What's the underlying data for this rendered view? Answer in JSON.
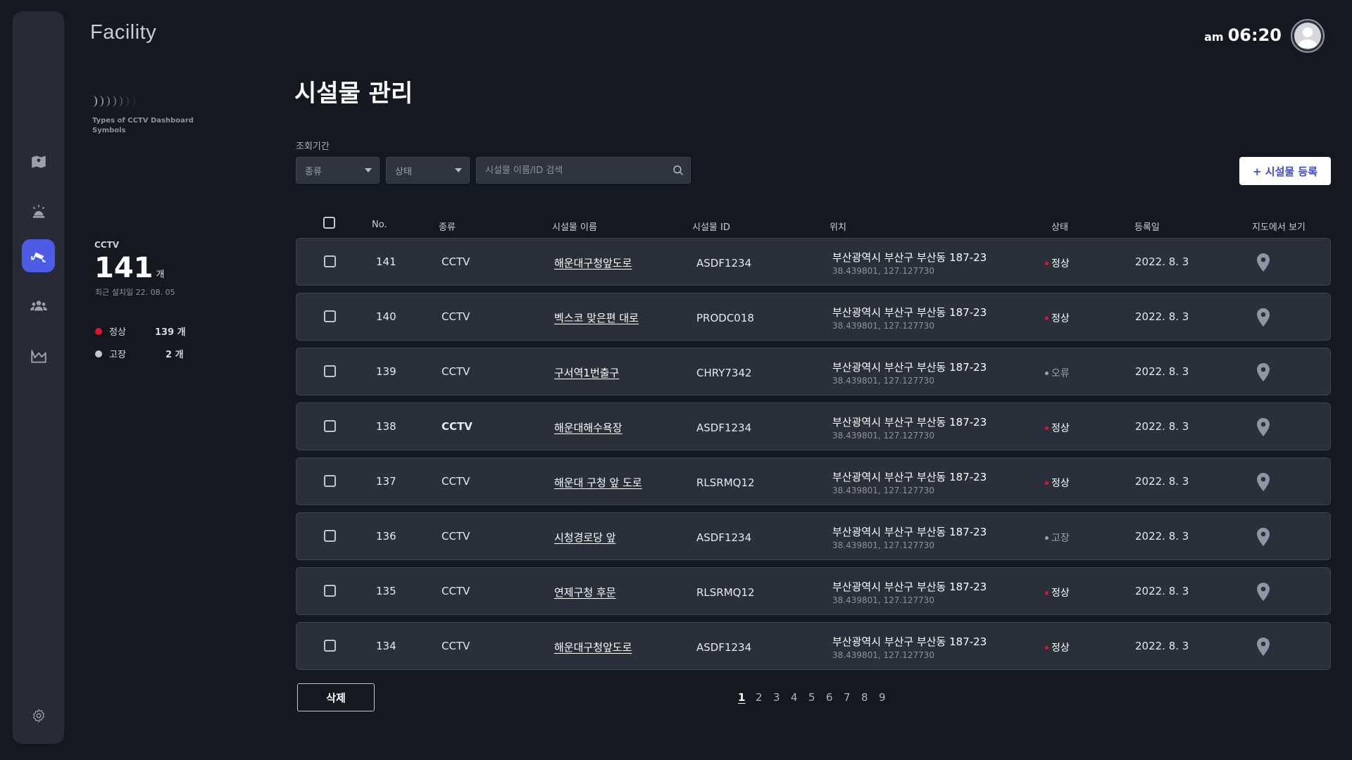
{
  "app": {
    "title": "Facility"
  },
  "clock": {
    "ampm": "am",
    "time": "06:20"
  },
  "sidebar": {
    "items": [
      {
        "name": "map",
        "icon": "map-icon",
        "active": false
      },
      {
        "name": "alarm",
        "icon": "siren-icon",
        "active": false
      },
      {
        "name": "facility",
        "icon": "cctv-icon",
        "active": true
      },
      {
        "name": "users",
        "icon": "users-icon",
        "active": false
      },
      {
        "name": "report",
        "icon": "landscape-icon",
        "active": false
      }
    ],
    "settings_icon": "gear-icon"
  },
  "info": {
    "symbols_caption": "Types of CCTV Dashboard Symbols",
    "category": "CCTV",
    "total": "141",
    "total_unit": "개",
    "last_installed": "최근 설치일 22. 08. 05",
    "legend": [
      {
        "label": "정상",
        "value": "139 개",
        "color": "#e0142b"
      },
      {
        "label": "고장",
        "value": "2 개",
        "color": "#c3c6cc"
      }
    ]
  },
  "main": {
    "title": "시설물 관리",
    "filter_label": "조회기간",
    "type_select": "종류",
    "status_select": "상태",
    "search_placeholder": "시설물 이름/ID 검색",
    "add_button": "+ 시설물 등록"
  },
  "table": {
    "headers": {
      "no": "No.",
      "type": "종류",
      "name": "시설물 이름",
      "id": "시설물 ID",
      "location": "위치",
      "status": "상태",
      "date": "등록일",
      "map": "지도에서 보기"
    },
    "rows": [
      {
        "no": "141",
        "type": "CCTV",
        "name": "해운대구청앞도로",
        "id": "ASDF1234",
        "address": "부산광역시 부산구 부산동 187-23",
        "coord": "38.439801, 127.127730",
        "status": "정상",
        "status_color": "#e0142b",
        "status_text_color": "#ffffff",
        "date": "2022. 8. 3"
      },
      {
        "no": "140",
        "type": "CCTV",
        "name": "벡스코 맞은편 대로",
        "id": "PRODC018",
        "address": "부산광역시 부산구 부산동 187-23",
        "coord": "38.439801, 127.127730",
        "status": "정상",
        "status_color": "#e0142b",
        "status_text_color": "#ffffff",
        "date": "2022. 8. 3"
      },
      {
        "no": "139",
        "type": "CCTV",
        "name": "구서역1번출구",
        "id": "CHRY7342",
        "address": "부산광역시 부산구 부산동 187-23",
        "coord": "38.439801, 127.127730",
        "status": "오류",
        "status_color": "#9ba1ab",
        "status_text_color": "#9ba1ab",
        "date": "2022. 8. 3"
      },
      {
        "no": "138",
        "type": "CCTV",
        "name": "해운대해수욕장",
        "id": "ASDF1234",
        "address": "부산광역시 부산구 부산동 187-23",
        "coord": "38.439801, 127.127730",
        "status": "정상",
        "status_color": "#e0142b",
        "status_text_color": "#ffffff",
        "date": "2022. 8. 3"
      },
      {
        "no": "137",
        "type": "CCTV",
        "name": "해운대 구청 앞 도로",
        "id": "RLSRMQ12",
        "address": "부산광역시 부산구 부산동 187-23",
        "coord": "38.439801, 127.127730",
        "status": "정상",
        "status_color": "#e0142b",
        "status_text_color": "#ffffff",
        "date": "2022. 8. 3"
      },
      {
        "no": "136",
        "type": "CCTV",
        "name": "시청경로당 앞",
        "id": "ASDF1234",
        "address": "부산광역시 부산구 부산동 187-23",
        "coord": "38.439801, 127.127730",
        "status": "고장",
        "status_color": "#9ba1ab",
        "status_text_color": "#9ba1ab",
        "date": "2022. 8. 3"
      },
      {
        "no": "135",
        "type": "CCTV",
        "name": "연제구청 후문",
        "id": "RLSRMQ12",
        "address": "부산광역시 부산구 부산동 187-23",
        "coord": "38.439801, 127.127730",
        "status": "정상",
        "status_color": "#e0142b",
        "status_text_color": "#ffffff",
        "date": "2022. 8. 3"
      },
      {
        "no": "134",
        "type": "CCTV",
        "name": "해운대구청앞도로",
        "id": "ASDF1234",
        "address": "부산광역시 부산구 부산동 187-23",
        "coord": "38.439801, 127.127730",
        "status": "정상",
        "status_color": "#e0142b",
        "status_text_color": "#ffffff",
        "date": "2022. 8. 3"
      }
    ]
  },
  "footer": {
    "delete_button": "삭제",
    "pages": [
      "1",
      "2",
      "3",
      "4",
      "5",
      "6",
      "7",
      "8",
      "9"
    ],
    "current_page": "1"
  },
  "colors": {
    "accent": "#4c5ce6",
    "normal": "#e0142b",
    "fault": "#c3c6cc",
    "bg": "#141821",
    "panel": "#262b36"
  }
}
